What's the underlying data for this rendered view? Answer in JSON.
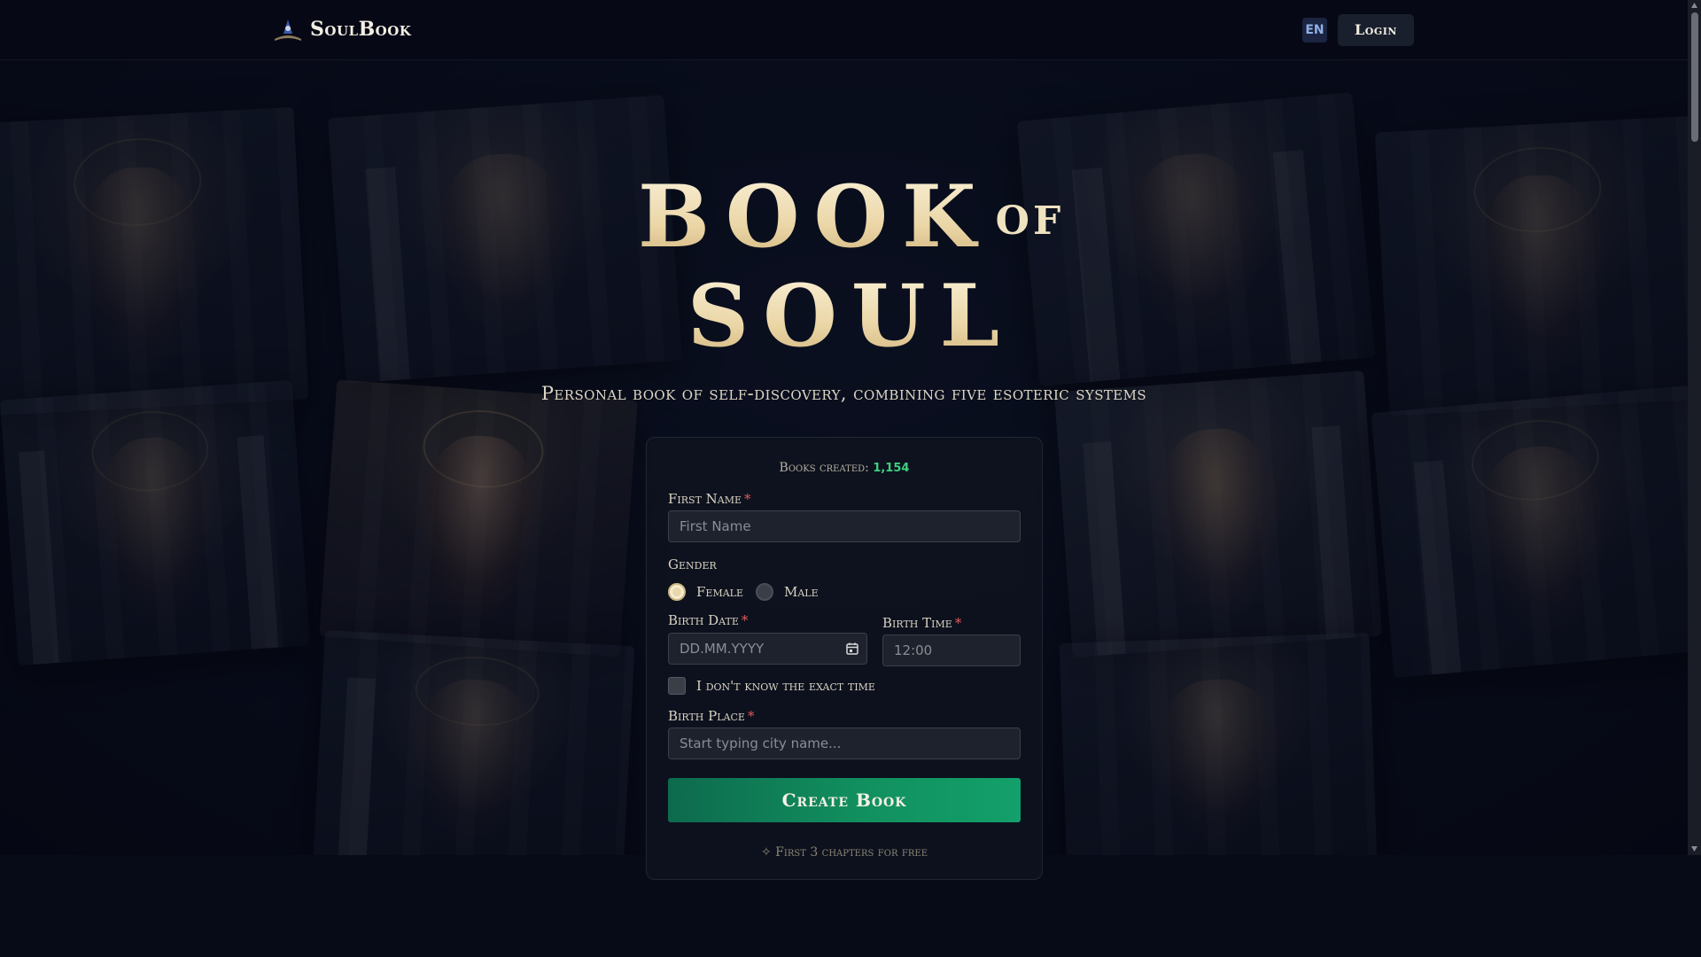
{
  "header": {
    "brand": "SoulBook",
    "language": "EN",
    "login_label": "Login"
  },
  "hero": {
    "title_word1": "BOOK",
    "title_word2": "OF",
    "title_word3": "SOUL",
    "subtitle": "Personal book of self-discovery, combining five esoteric systems"
  },
  "form": {
    "counter_label": "Books created:",
    "counter_value": "1,154",
    "first_name_label": "First Name",
    "first_name_placeholder": "First Name",
    "required_mark": "*",
    "gender_label": "Gender",
    "gender_options": [
      "Female",
      "Male"
    ],
    "gender_selected": "Female",
    "birth_date_label": "Birth Date",
    "birth_date_placeholder": "DD.MM.YYYY",
    "birth_time_label": "Birth Time",
    "birth_time_value": "12:00",
    "unknown_time_label": "I don't know the exact time",
    "unknown_time_checked": false,
    "birth_place_label": "Birth Place",
    "birth_place_placeholder": "Start typing city name...",
    "submit_label": "Create Book",
    "free_note": "✧ First 3 chapters for free"
  },
  "colors": {
    "accent_green": "#11905f",
    "counter_green": "#3fd07f",
    "title_gold": "#ead5a5",
    "required_red": "#e05a5a",
    "background": "#070b18"
  }
}
